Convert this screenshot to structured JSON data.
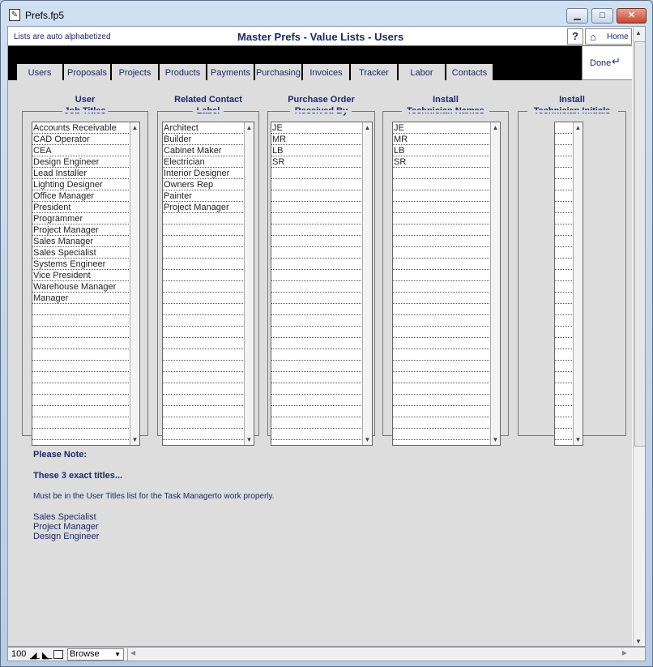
{
  "window": {
    "title": "Prefs.fp5",
    "icon": "document-icon",
    "controls": {
      "minimize": "▁",
      "maximize": "□",
      "close": "✕"
    }
  },
  "header": {
    "auto_note": "Lists are auto alphabetized",
    "title": "Master Prefs - Value Lists - Users",
    "help_label": "?",
    "home_label": "Home",
    "done_label": "Done"
  },
  "tabs": [
    {
      "label": "Users",
      "active": true
    },
    {
      "label": "Proposals"
    },
    {
      "label": "Projects"
    },
    {
      "label": "Products"
    },
    {
      "label": "Payments"
    },
    {
      "label": "Purchasing"
    },
    {
      "label": "Invoices"
    },
    {
      "label": "Tracker"
    },
    {
      "label": "Labor"
    },
    {
      "label": "Contacts"
    }
  ],
  "groups": [
    {
      "title_line1": "User",
      "title_line2": "Job Titles",
      "items": [
        "Accounts Receivable",
        "CAD Operator",
        "CEA",
        "Design Engineer",
        "Lead Installer",
        "Lighting Designer",
        "Office Manager",
        "President",
        "Programmer",
        "Project Manager",
        "Sales Manager",
        "Sales Specialist",
        "Systems Engineer",
        "Vice President",
        "Warehouse Manager",
        "Manager"
      ]
    },
    {
      "title_line1": "Related Contact",
      "title_line2": "Label",
      "items": [
        "Architect",
        "Builder",
        "Cabinet Maker",
        "Electrician",
        "Interior Designer",
        "Owners Rep",
        "Painter",
        "Project Manager"
      ]
    },
    {
      "title_line1": "Purchase Order",
      "title_line2": "Received By",
      "items": [
        "JE",
        "MR",
        "LB",
        "SR"
      ]
    },
    {
      "title_line1": "Install",
      "title_line2": "Technician Names",
      "items": [
        "JE",
        "MR",
        "LB",
        "SR"
      ]
    },
    {
      "title_line1": "Install",
      "title_line2": "Technician Initials",
      "items": []
    }
  ],
  "note": {
    "heading": "Please Note:",
    "subheading": "These 3 exact titles...",
    "body": "Must be in the User Titles list for the Task Managerto work properly.",
    "titles": [
      "Sales Specialist",
      "Project Manager",
      "Design Engineer"
    ]
  },
  "statusbar": {
    "zoom": "100",
    "mode": "Browse"
  },
  "colors": {
    "label_text": "#1a2a6c",
    "panel_bg": "#dddddd",
    "band": "#000000"
  }
}
